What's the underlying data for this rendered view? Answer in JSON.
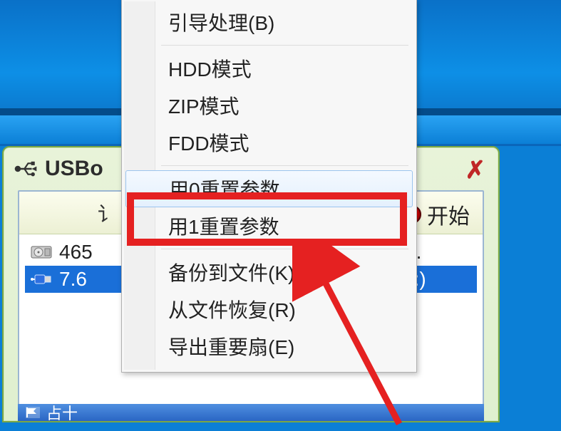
{
  "app": {
    "title_prefix": "USBo"
  },
  "toolbar": {
    "left_text": "讠",
    "start_label": "开始"
  },
  "drives": [
    {
      "label": "465",
      "tail": "( . ."
    },
    {
      "label": "7.6",
      "tail": "(H:)"
    }
  ],
  "bottom": {
    "text": "占十"
  },
  "menu": {
    "items": [
      {
        "label": "引导处理(B)"
      },
      {
        "sep": true
      },
      {
        "label": "HDD模式"
      },
      {
        "label": "ZIP模式"
      },
      {
        "label": "FDD模式"
      },
      {
        "sep": true
      },
      {
        "label": "用0重置参数",
        "hover": true
      },
      {
        "label": "用1重置参数"
      },
      {
        "sep": true
      },
      {
        "label": "备份到文件(K)"
      },
      {
        "label": "从文件恢复(R)"
      },
      {
        "label": "导出重要扇(E)"
      }
    ]
  }
}
